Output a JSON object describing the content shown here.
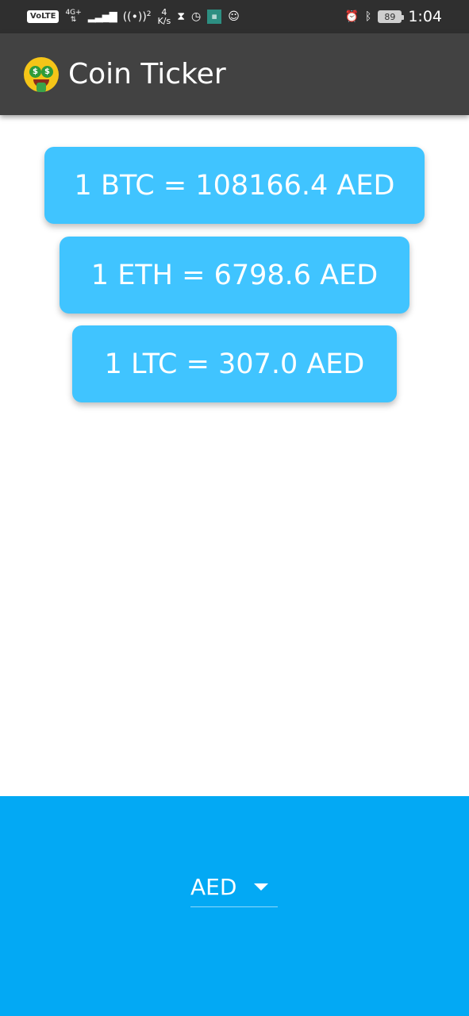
{
  "status_bar": {
    "volte": "VoLTE",
    "network": "4G+",
    "hotspot_count": "2",
    "speed_value": "4",
    "speed_unit": "K/s",
    "battery": "89",
    "time": "1:04"
  },
  "app_bar": {
    "title": "Coin Ticker"
  },
  "rates": [
    {
      "text": "1 BTC = 108166.4 AED"
    },
    {
      "text": "1 ETH = 6798.6 AED"
    },
    {
      "text": "1 LTC = 307.0 AED"
    }
  ],
  "currency_picker": {
    "selected": "AED"
  },
  "colors": {
    "app_bar": "#424242",
    "card": "#40c4ff",
    "bottom_panel": "#03a9f4"
  }
}
